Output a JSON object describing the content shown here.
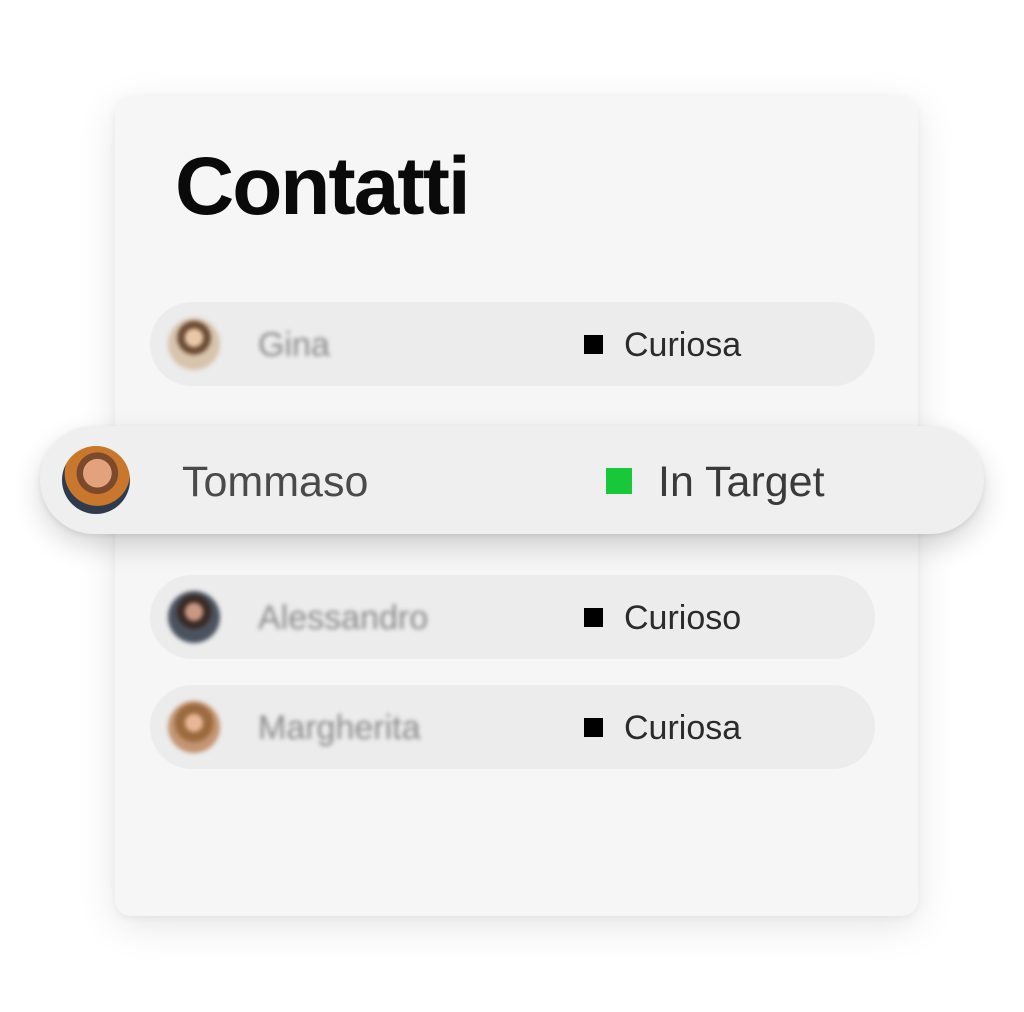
{
  "title": "Contatti",
  "contacts": [
    {
      "name": "Gina",
      "status": "Curiosa",
      "status_color": "#000000",
      "avatar": "gina-avatar"
    },
    {
      "name": "Tommaso",
      "status": "In Target",
      "status_color": "#19c73a",
      "avatar": "tommaso-avatar",
      "selected": true
    },
    {
      "name": "Alessandro",
      "status": "Curioso",
      "status_color": "#000000",
      "avatar": "alessandro-avatar"
    },
    {
      "name": "Margherita",
      "status": "Curiosa",
      "status_color": "#000000",
      "avatar": "margherita-avatar"
    }
  ],
  "colors": {
    "card_background": "#f6f6f6",
    "row_background": "#ececec",
    "active_status": "#19c73a",
    "inactive_status": "#000000"
  }
}
